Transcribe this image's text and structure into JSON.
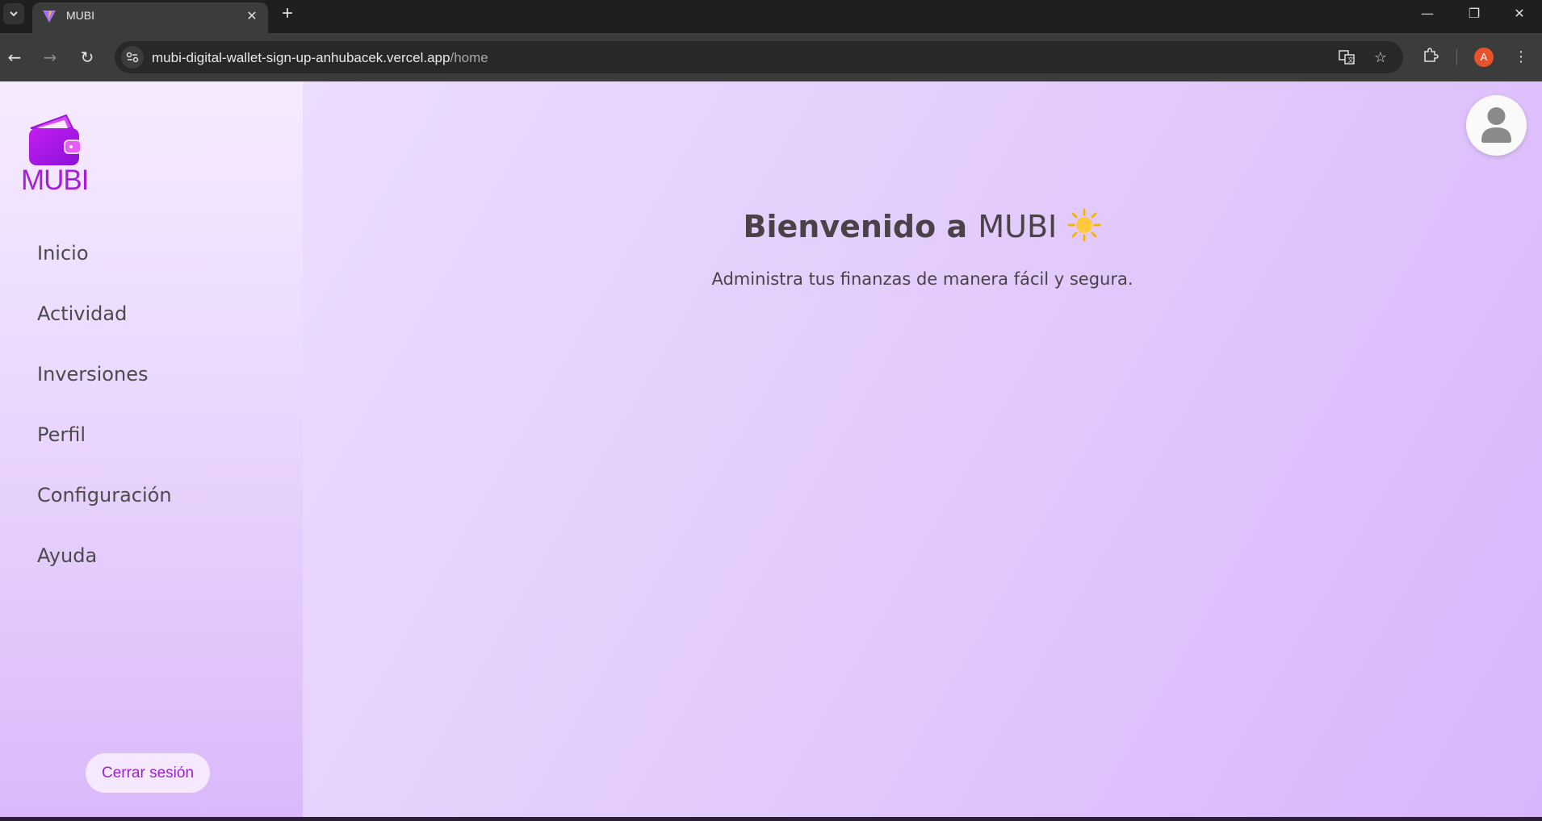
{
  "browser": {
    "tab_title": "MUBI",
    "url_host": "mubi-digital-wallet-sign-up-anhubacek.vercel.app",
    "url_path": "/home",
    "profile_initial": "A"
  },
  "sidebar": {
    "logo_text": "MUBI",
    "items": [
      {
        "label": "Inicio"
      },
      {
        "label": "Actividad"
      },
      {
        "label": "Inversiones"
      },
      {
        "label": "Perfil"
      },
      {
        "label": "Configuración"
      },
      {
        "label": "Ayuda"
      }
    ],
    "logout_label": "Cerrar sesión"
  },
  "main": {
    "welcome_prefix": "Bienvenido a",
    "welcome_brand": "MUBI",
    "welcome_emoji": "sun-icon",
    "subtitle": "Administra tus finanzas de manera fácil y segura."
  },
  "colors": {
    "brand_purple": "#a51ed9",
    "text_dark": "#4a4247"
  }
}
